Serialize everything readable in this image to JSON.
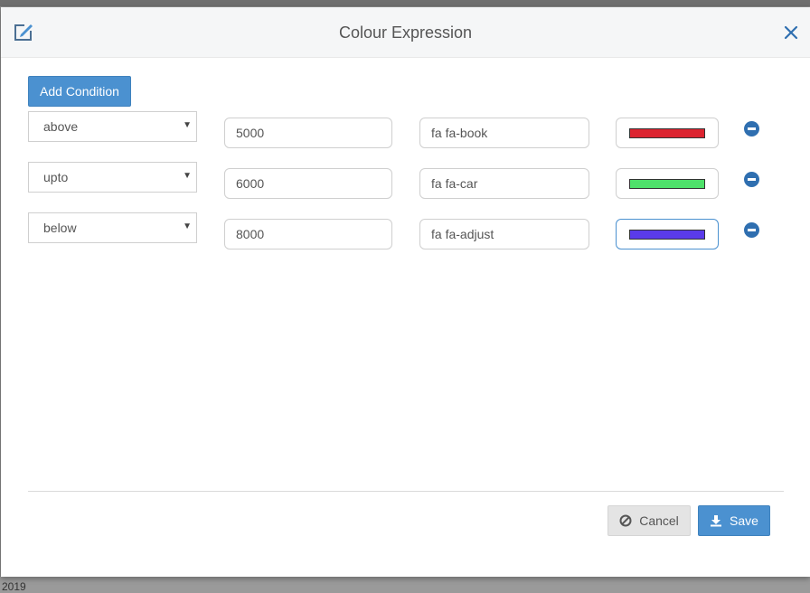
{
  "dialog": {
    "title": "Colour Expression",
    "add_condition_label": "Add Condition",
    "cancel_label": "Cancel",
    "save_label": "Save"
  },
  "conditions": [
    {
      "operator": "above",
      "value": "5000",
      "icon": "fa fa-book",
      "color": "#dc2430"
    },
    {
      "operator": "upto",
      "value": "6000",
      "icon": "fa fa-car",
      "color": "#4ee16a"
    },
    {
      "operator": "below",
      "value": "8000",
      "icon": "fa fa-adjust",
      "color": "#5a3bea"
    }
  ],
  "background": {
    "text": "2019"
  },
  "colors": {
    "accent": "#4b91d0",
    "remove": "#2f6fb0"
  },
  "icons": {
    "header": "edit-icon",
    "close": "close-icon",
    "remove": "minus-circle-icon",
    "cancel": "ban-icon",
    "save": "download-icon"
  }
}
